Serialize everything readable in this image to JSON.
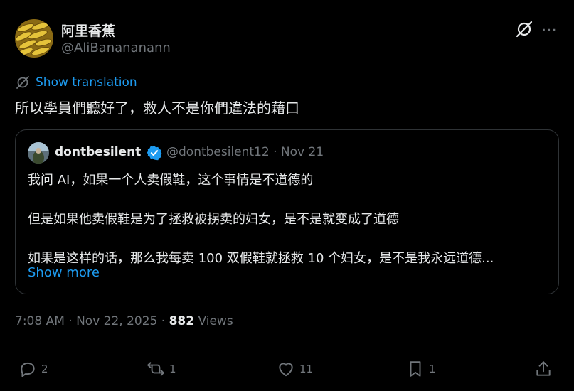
{
  "post": {
    "author_name": "阿里香蕉",
    "author_handle": "@AliBanananann",
    "show_translation": "Show translation",
    "text": "所以學員們聽好了，救人不是你們違法的藉口",
    "timestamp": "7:08 AM · Nov 22, 2025 · ",
    "views_count": "882",
    "views_label": " Views",
    "more_icon": "⋯"
  },
  "quote": {
    "author_name": "dontbesilent",
    "author_handle": "@dontbesilent12 · Nov 21",
    "line1": "我问 AI，如果一个人卖假鞋，这个事情是不道德的",
    "line2": "但是如果他卖假鞋是为了拯救被拐卖的妇女，是不是就变成了道德",
    "line3": "如果是这样的话，那么我每卖 100 双假鞋就拯救 10 个妇女，是不是我永远道德...",
    "show_more": "Show more"
  },
  "actions": {
    "replies": "2",
    "reposts": "1",
    "likes": "11",
    "bookmarks": "1"
  },
  "colors": {
    "background": "#000000",
    "text": "#e7e9ea",
    "muted": "#71767b",
    "link": "#1d9bf0",
    "border": "#2f3336",
    "verified": "#1d9bf0"
  }
}
